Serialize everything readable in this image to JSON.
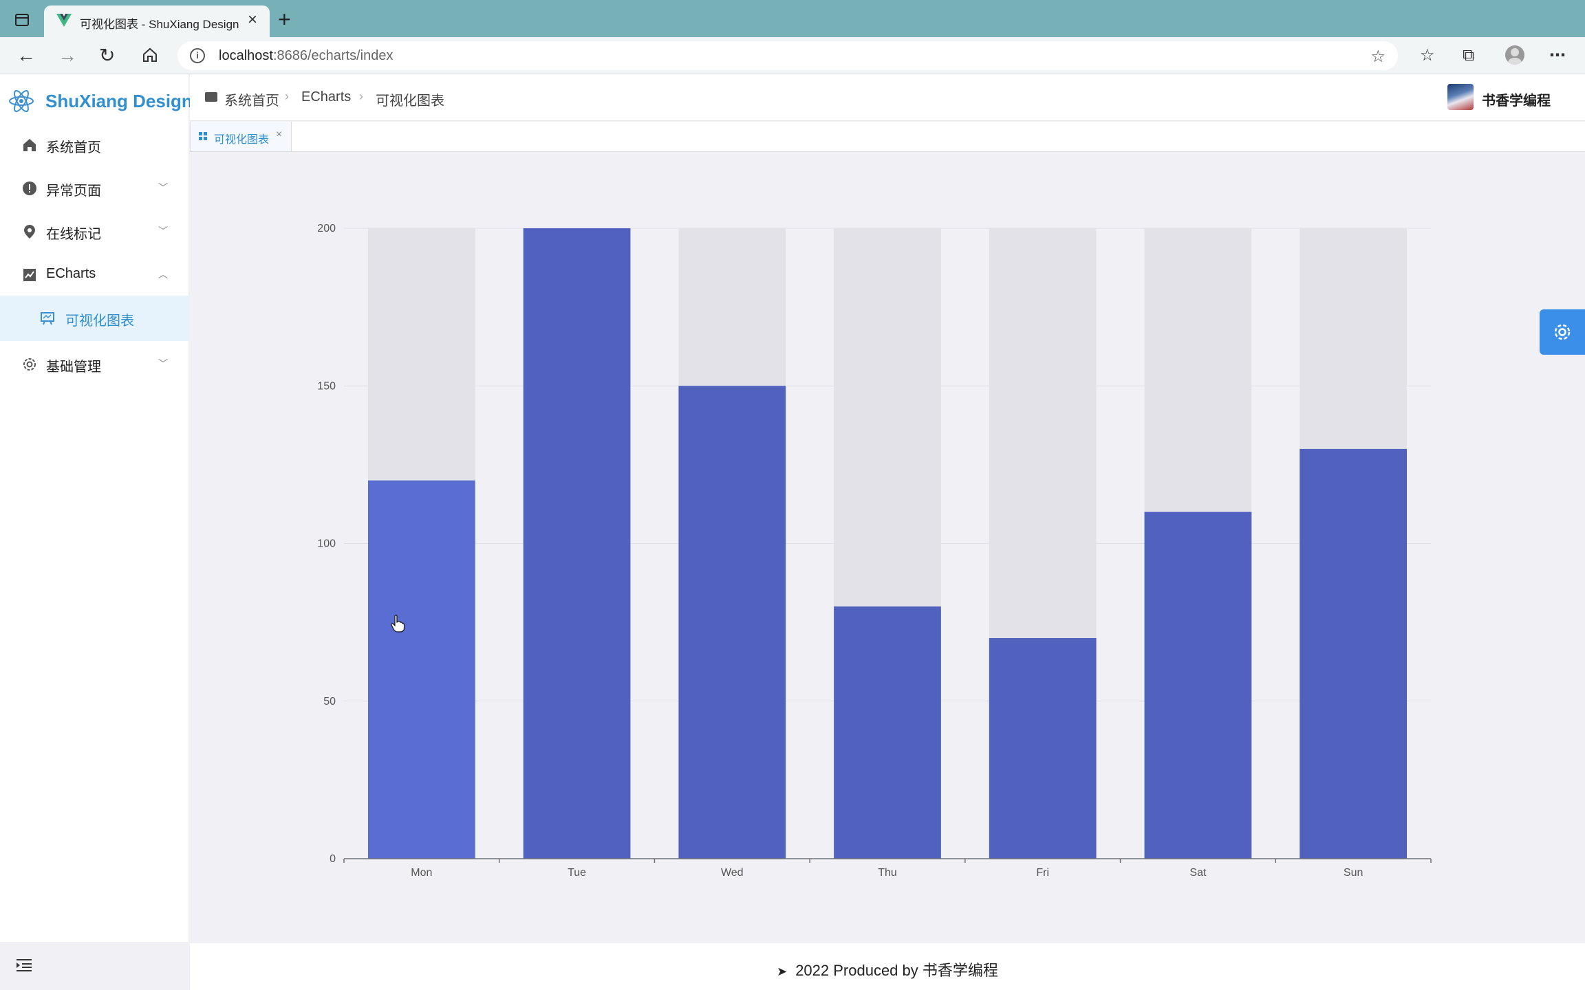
{
  "browser": {
    "tab_title": "可视化图表 - ShuXiang Design",
    "tab_close": "×",
    "new_tab": "+",
    "url_host": "localhost",
    "url_rest": ":8686/echarts/index"
  },
  "app": {
    "logo_text": "ShuXiang Design",
    "brand_color": "#2f8fd0"
  },
  "sidebar": {
    "items": [
      {
        "label": "系统首页",
        "icon": "home-icon"
      },
      {
        "label": "异常页面",
        "icon": "warning-icon",
        "expandable": true,
        "expanded": false
      },
      {
        "label": "在线标记",
        "icon": "location-icon",
        "expandable": true,
        "expanded": false
      },
      {
        "label": "ECharts",
        "icon": "chart-icon",
        "expandable": true,
        "expanded": true
      },
      {
        "label": "可视化图表",
        "icon": "presentation-icon",
        "sub": true,
        "active": true
      },
      {
        "label": "基础管理",
        "icon": "settings-icon",
        "expandable": true,
        "expanded": false
      }
    ]
  },
  "header": {
    "breadcrumb": [
      "系统首页",
      "ECharts",
      "可视化图表"
    ],
    "username": "书香学编程"
  },
  "tags": {
    "active_tag": "可视化图表",
    "close": "×"
  },
  "footer": {
    "text": "2022 Produced by 书香学编程"
  },
  "chart_data": {
    "type": "bar",
    "categories": [
      "Mon",
      "Tue",
      "Wed",
      "Thu",
      "Fri",
      "Sat",
      "Sun"
    ],
    "values": [
      120,
      200,
      150,
      80,
      70,
      110,
      130
    ],
    "background_bar_max": 200,
    "ylim": [
      0,
      200
    ],
    "yticks": [
      0,
      50,
      100,
      150,
      200
    ],
    "bar_color": "#5061be",
    "highlight_color": "#5a6dd2",
    "background_color": "#e2e2e8",
    "grid": true
  }
}
